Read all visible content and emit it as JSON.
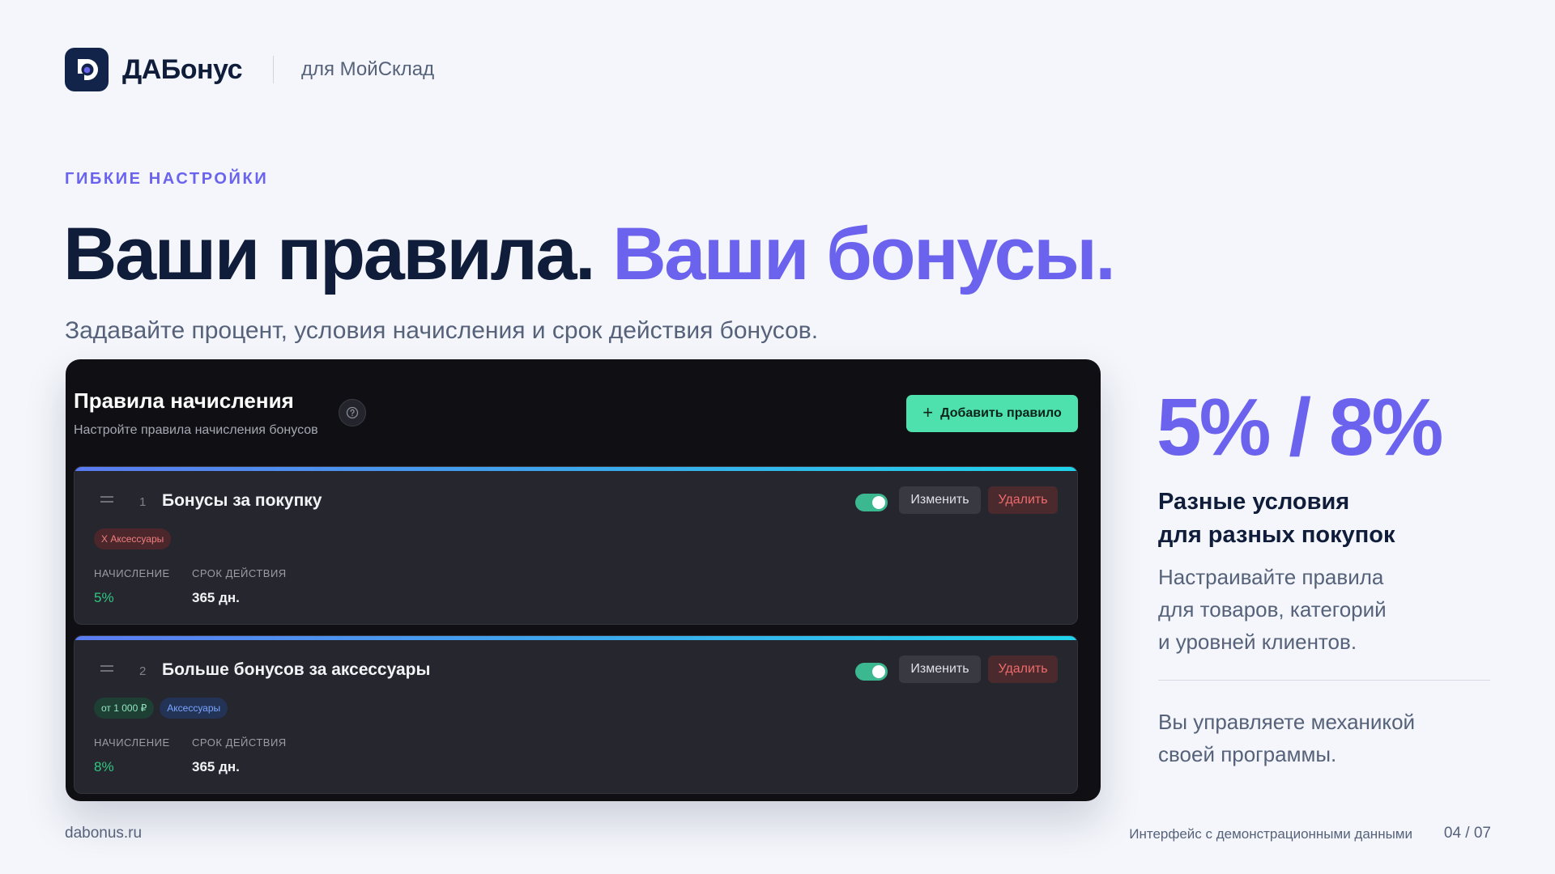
{
  "brand": {
    "name": "ДАБонус",
    "subtitle": "для МойСклад"
  },
  "hero": {
    "kicker": "ГИБКИЕ НАСТРОЙКИ",
    "headline_dark": "Ваши правила.",
    "headline_accent": "Ваши бонусы.",
    "subline": "Задавайте процент, условия начисления и срок действия бонусов."
  },
  "app": {
    "title": "Правила начисления",
    "subtitle": "Настройте правила начисления бонусов",
    "add_button": "Добавить правило",
    "accrual_label": "НАЧИСЛЕНИЕ",
    "validity_label": "СРОК ДЕЙСТВИЯ",
    "edit_label": "Изменить",
    "delete_label": "Удалить",
    "rules": [
      {
        "index": "1",
        "title": "Бонусы за покупку",
        "enabled": true,
        "tags": [
          "X Аксессуары"
        ],
        "accrual": "5%",
        "validity": "365 дн."
      },
      {
        "index": "2",
        "title": "Больше бонусов за аксессуары",
        "enabled": true,
        "tags": [
          "от 1 000 ₽",
          "Аксессуары"
        ],
        "accrual": "8%",
        "validity": "365 дн."
      }
    ]
  },
  "side": {
    "stat": "5% / 8%",
    "heading_line1": "Разные условия",
    "heading_line2": "для разных покупок",
    "text_line1": "Настраивайте правила",
    "text_line2": "для товаров, категорий",
    "text_line3": "и уровней клиентов.",
    "text2_line1": "Вы управляете механикой",
    "text2_line2": "своей программы."
  },
  "footer": {
    "site": "dabonus.ru",
    "note": "Интерфейс с демонстрационными данными",
    "page": "04 / 07"
  },
  "colors": {
    "accent": "#6b63ee",
    "navy": "#0f1d3a",
    "mint": "#4ee0ad",
    "danger": "#ef6b6b",
    "panel": "#0f0f14"
  }
}
